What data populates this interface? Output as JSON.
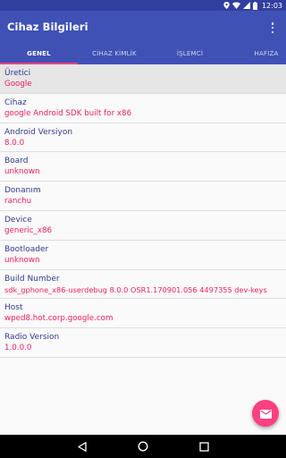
{
  "status_bar": {
    "time": "12:03"
  },
  "app_bar": {
    "title": "Cihaz Bilgileri"
  },
  "tabs": [
    {
      "label": "GENEL",
      "active": true
    },
    {
      "label": "CİHAZ KİMLİK",
      "active": false
    },
    {
      "label": "İŞLEMCİ",
      "active": false
    },
    {
      "label": "HAFIZA",
      "active": false
    }
  ],
  "rows": [
    {
      "label": "Üretici",
      "value": "Google"
    },
    {
      "label": "Cihaz",
      "value": "google Android SDK built for x86"
    },
    {
      "label": "Android Versiyon",
      "value": "8.0.0"
    },
    {
      "label": "Board",
      "value": "unknown"
    },
    {
      "label": "Donanım",
      "value": "ranchu"
    },
    {
      "label": "Device",
      "value": "generic_x86"
    },
    {
      "label": "Bootloader",
      "value": "unknown"
    },
    {
      "label": "Build Number",
      "value": "sdk_gphone_x86-userdebug 8.0.0 OSR1.170901.056 4497355 dev-keys"
    },
    {
      "label": "Host",
      "value": "wped8.hot.corp.google.com"
    },
    {
      "label": "Radio Version",
      "value": "1.0.0.0"
    }
  ],
  "colors": {
    "primary": "#3f51b5",
    "primary_dark": "#303f9f",
    "accent": "#ff4081"
  },
  "icons": {
    "fab": "email-icon",
    "overflow": "more-vert-icon"
  }
}
